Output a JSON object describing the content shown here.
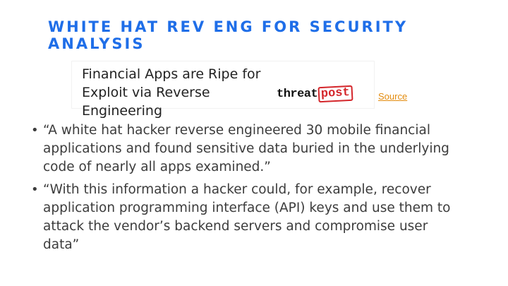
{
  "slide": {
    "title": "WHITE HAT REV ENG FOR SECURITY ANALYSIS",
    "headline_image": {
      "text": "Financial Apps are Ripe for Exploit via Reverse Engineering",
      "logo_threat": "threat",
      "logo_post": "post"
    },
    "source_label": "Source",
    "bullets": [
      "“A white hat hacker reverse engineered 30 mobile financial applications and found sensitive data buried in the underlying code of nearly all apps examined.”",
      "“With this information a hacker could, for example, recover application programming interface (API) keys and use them to attack the vendor’s backend servers and compromise user data”"
    ],
    "bullet_glyph": "•"
  },
  "colors": {
    "title": "#1f6ee8",
    "link": "#e38b0d",
    "logo_accent": "#d4262b",
    "body_text": "#3c3c3c"
  }
}
